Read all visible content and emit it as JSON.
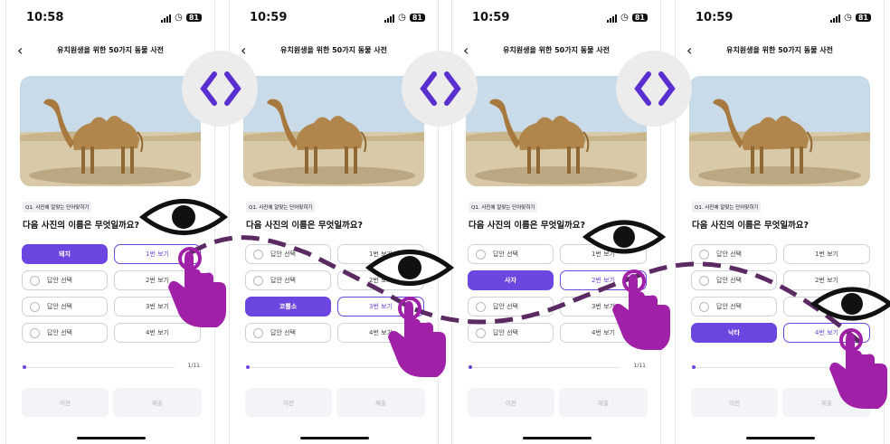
{
  "phones": [
    {
      "time": "10:58",
      "battery": "81",
      "title": "유치원생을 위한 50가지 동물 사전",
      "question_label": "Q1. 사진에 알맞는 단어맞히기",
      "question": "다음 사진의 이름은 무엇일까요?",
      "answers": [
        "돼지",
        "답안 선택",
        "답안 선택",
        "답안 선택"
      ],
      "views": [
        "1번 보기",
        "2번 보기",
        "3번 보기",
        "4번 보기"
      ],
      "progress": "1/11",
      "prev": "이전",
      "submit": "제출"
    },
    {
      "time": "10:59",
      "battery": "81",
      "title": "유치원생을 위한 50가지 동물 사전",
      "question_label": "Q1. 사진에 알맞는 단어맞히기",
      "question": "다음 사진의 이름은 무엇일까요?",
      "answers": [
        "답안 선택",
        "답안 선택",
        "코뿔소",
        "답안 선택"
      ],
      "views": [
        "1번 보기",
        "2번 보기",
        "3번 보기",
        "4번 보기"
      ],
      "progress": "",
      "prev": "이전",
      "submit": "제출"
    },
    {
      "time": "10:59",
      "battery": "81",
      "title": "유치원생을 위한 50가지 동물 사전",
      "question_label": "Q1. 사진에 알맞는 단어맞히기",
      "question": "다음 사진의 이름은 무엇일까요?",
      "answers": [
        "답안 선택",
        "사자",
        "답안 선택",
        "답안 선택"
      ],
      "views": [
        "1번 보기",
        "2번 보기",
        "3번 보기",
        "4번 보기"
      ],
      "progress": "1/11",
      "prev": "이전",
      "submit": "제출"
    },
    {
      "time": "10:59",
      "battery": "81",
      "title": "유치원생을 위한 50가지 동물 사전",
      "question_label": "Q1. 사진에 알맞는 단어맞히기",
      "question": "다음 사진의 이름은 무엇일까요?",
      "answers": [
        "답안 선택",
        "답안 선택",
        "답안 선택",
        "낙타"
      ],
      "views": [
        "1번 보기",
        "2번 보기",
        "3번 보기",
        "4번 보기"
      ],
      "progress": "",
      "prev": "이전",
      "submit": "제출"
    }
  ],
  "selected_answer_index": [
    0,
    2,
    1,
    3
  ],
  "colors": {
    "accent": "#6d45e0",
    "overlay_path": "#5b2a63",
    "hand": "#a020a8"
  },
  "icons": [
    "back-chevron-icon",
    "eye-icon",
    "pointing-hand-icon",
    "prev-next-chevron-icon",
    "camel-photo"
  ]
}
